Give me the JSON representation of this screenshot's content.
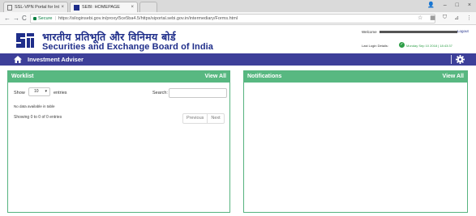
{
  "browser": {
    "tabs": [
      {
        "label": "SSL-VPN Portal for Inter",
        "close": "×",
        "icon": "page-icon"
      },
      {
        "label": "SEBI: HOMEPAGE",
        "close": "×",
        "icon": "sebi-favicon"
      },
      {
        "label": "",
        "icon": "new-tab"
      }
    ],
    "window_controls": {
      "user": "👤",
      "minimize": "–",
      "maximize": "□",
      "close": "×"
    },
    "nav": {
      "back": "←",
      "forward": "→",
      "reload": "C"
    },
    "address": {
      "secure_label": "Secure",
      "separator": "|",
      "url": "https://siloginsebi.gov.in/proxy/5ce5ba4.5/https/siportal.sebi.gov.in/intermediary/Forms.html"
    },
    "tools": {
      "star": "☆",
      "ext1": "▦",
      "ext2": "⛉",
      "ext3": "⊿",
      "menu": "⋮"
    }
  },
  "header": {
    "hindi_title": "भारतीय प्रतिभूति और विनिमय बोर्ड",
    "english_title": "Securities and Exchange Board of India",
    "welcome_label": "Welcome",
    "logout_label": "Logout",
    "last_login_label": "Last Login Details:",
    "last_login_value": "Monday Sep 10 2018 | 18:43:37",
    "check_icon": "✓",
    "colors": {
      "brand": "#1f2e8a",
      "success": "#2e9e47"
    }
  },
  "navbar": {
    "title": "Investment Adviser",
    "color": "#3d3f99"
  },
  "worklist": {
    "title": "Worklist",
    "view_all": "View All",
    "show_label": "Show",
    "page_length": "10",
    "entries_label": "entries",
    "search_label": "Search:",
    "search_value": "",
    "empty_message": "No data available in table",
    "info": "Showing 0 to 0 of 0 entries",
    "prev": "Previous",
    "next": "Next",
    "color": "#58b881"
  },
  "notifications": {
    "title": "Notifications",
    "view_all": "View All"
  }
}
